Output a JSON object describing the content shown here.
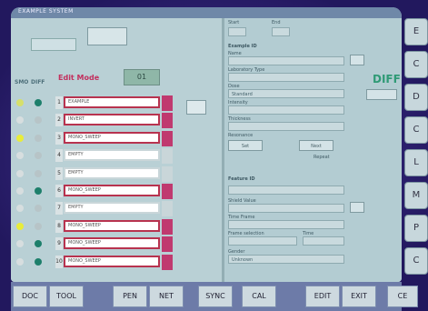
{
  "header": {
    "window_title": "EXAMPLE SYSTEM",
    "edit_mode_label": "Edit Mode",
    "edit_mode_value": "01"
  },
  "left": {
    "col_labels": [
      "SMO",
      "DIFF"
    ],
    "rows": [
      {
        "n": "1",
        "text": "EXAMPLE",
        "state": "red"
      },
      {
        "n": "2",
        "text": "INVERT",
        "state": "red"
      },
      {
        "n": "3",
        "text": "MONO_SWEEP",
        "state": "red"
      },
      {
        "n": "4",
        "text": "EMPTY",
        "state": "plain"
      },
      {
        "n": "5",
        "text": "EMPTY",
        "state": "plain"
      },
      {
        "n": "6",
        "text": "MONO_SWEEP",
        "state": "red"
      },
      {
        "n": "7",
        "text": "EMPTY",
        "state": "plain"
      },
      {
        "n": "8",
        "text": "MONO_SWEEP",
        "state": "red"
      },
      {
        "n": "9",
        "text": "MONO_SWEEP",
        "state": "red"
      },
      {
        "n": "10",
        "text": "MONO_SWEEP",
        "state": "red"
      }
    ]
  },
  "right": {
    "top_labels": [
      "Start",
      "End"
    ],
    "group1": {
      "title": "Example ID",
      "label1": "Name",
      "label2": "Laboratory Type",
      "label3": "Dose",
      "label4": "Intensity",
      "label5": "Thickness",
      "label6": "Resonance",
      "value3": "Standard"
    },
    "diff_label": "DIFF",
    "buttons": {
      "a": "Set",
      "b": "Next",
      "c": "Repeat"
    },
    "group2": {
      "title": "Feature ID",
      "label1": "Shield Value",
      "label2": "Time Frame",
      "label3": "Frame selection",
      "label4": "Time",
      "label5": "Gender",
      "value5": "Unknown"
    }
  },
  "sidebar_icons": [
    "E",
    "C",
    "D",
    "C",
    "L",
    "M",
    "P",
    "C"
  ],
  "bottom_buttons": [
    "DOC",
    "TOOL",
    "PEN",
    "NET",
    "SYNC",
    "CAL",
    "EDIT",
    "EXIT",
    "CE"
  ]
}
